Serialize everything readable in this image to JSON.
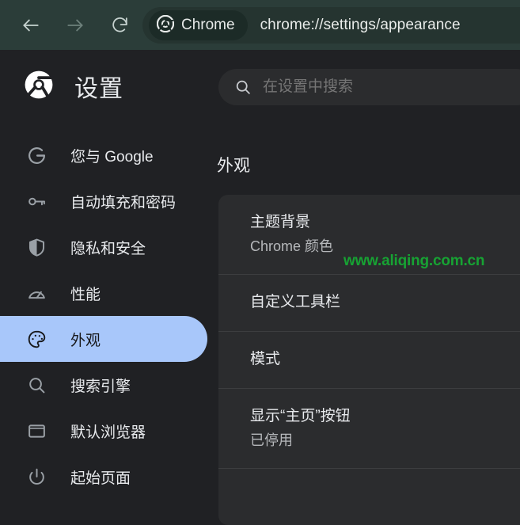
{
  "browser": {
    "back_icon": "arrow-left-icon",
    "forward_icon": "arrow-right-icon",
    "reload_icon": "reload-icon",
    "chip_label": "Chrome",
    "chip_icon": "chrome-logo-icon",
    "url": "chrome://settings/appearance",
    "toolbar_color": "#2b3d39",
    "omnibox_color": "#253430"
  },
  "settings": {
    "logo_icon": "chrome-logo-icon",
    "title": "设置",
    "search": {
      "icon": "search-icon",
      "placeholder": "在设置中搜索",
      "value": ""
    },
    "sidebar": {
      "items": [
        {
          "label": "您与 Google",
          "icon": "google-g-icon",
          "active": false
        },
        {
          "label": "自动填充和密码",
          "icon": "key-icon",
          "active": false
        },
        {
          "label": "隐私和安全",
          "icon": "shield-icon",
          "active": false
        },
        {
          "label": "性能",
          "icon": "speedometer-icon",
          "active": false
        },
        {
          "label": "外观",
          "icon": "palette-icon",
          "active": true
        },
        {
          "label": "搜索引擎",
          "icon": "search-icon",
          "active": false
        },
        {
          "label": "默认浏览器",
          "icon": "browser-window-icon",
          "active": false
        },
        {
          "label": "起始页面",
          "icon": "power-icon",
          "active": false
        }
      ],
      "active_color": "#a8c7fa"
    },
    "main": {
      "heading": "外观",
      "rows": [
        {
          "title": "主题背景",
          "sub": "Chrome 颜色"
        },
        {
          "title": "自定义工具栏",
          "sub": ""
        },
        {
          "title": "模式",
          "sub": ""
        },
        {
          "title": "显示“主页”按钮",
          "sub": "已停用"
        }
      ]
    }
  },
  "watermark": {
    "text": "www.aliqing.com.cn",
    "color": "#17a233"
  }
}
